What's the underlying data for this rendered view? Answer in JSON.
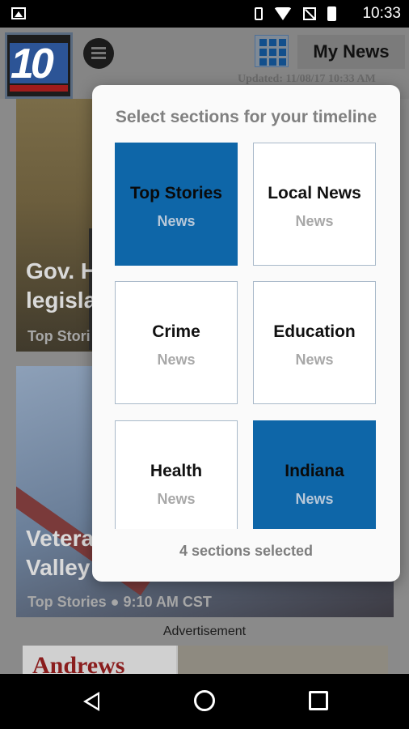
{
  "status_bar": {
    "time": "10:33"
  },
  "header": {
    "logo_text": "10",
    "my_news_label": "My News",
    "updated_text": "Updated: 11/08/17 10:33 AM"
  },
  "cards": [
    {
      "title_line1": "Gov. H",
      "title_line2": "legisla",
      "meta": "Top Stori"
    },
    {
      "title_line1": "Vetera",
      "title_line2": "Valley",
      "meta": "Top Stories  ●  9:10 AM CST"
    }
  ],
  "ad": {
    "label": "Advertisement",
    "brand_text": "Andrews"
  },
  "dialog": {
    "title": "Select sections for your timeline",
    "footer": "4 sections selected",
    "sections": [
      {
        "name": "Top Stories",
        "sub": "News",
        "selected": true
      },
      {
        "name": "Local News",
        "sub": "News",
        "selected": false
      },
      {
        "name": "Crime",
        "sub": "News",
        "selected": false
      },
      {
        "name": "Education",
        "sub": "News",
        "selected": false
      },
      {
        "name": "Health",
        "sub": "News",
        "selected": false
      },
      {
        "name": "Indiana",
        "sub": "News",
        "selected": true
      }
    ]
  },
  "colors": {
    "selected_tile": "#0e66a8",
    "tile_border": "#a9b9c9"
  },
  "icons": [
    "gallery-icon",
    "vibrate-icon",
    "wifi-icon",
    "no-signal-icon",
    "battery-icon",
    "menu-icon",
    "grid-icon",
    "back-icon",
    "home-icon",
    "recents-icon"
  ]
}
